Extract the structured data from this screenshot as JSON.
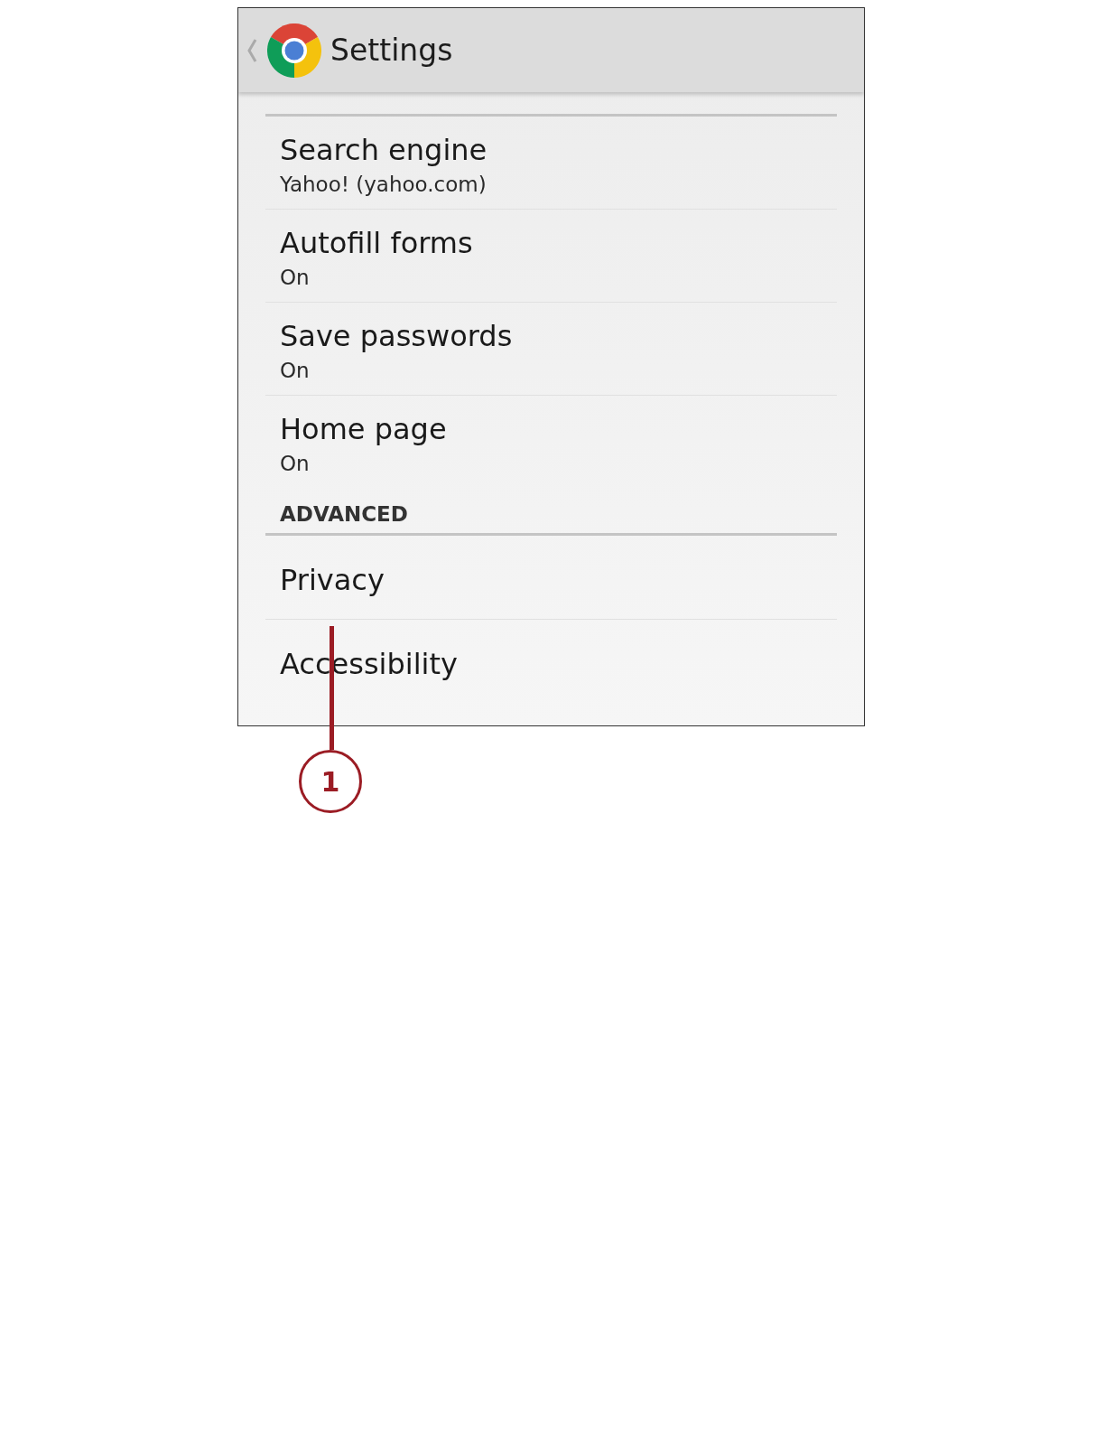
{
  "header": {
    "title": "Settings"
  },
  "items": [
    {
      "kind": "setting",
      "title": "Search engine",
      "summary": "Yahoo! (yahoo.com)"
    },
    {
      "kind": "setting",
      "title": "Autofill forms",
      "summary": "On"
    },
    {
      "kind": "setting",
      "title": "Save passwords",
      "summary": "On"
    },
    {
      "kind": "setting",
      "title": "Home page",
      "summary": "On"
    },
    {
      "kind": "heading",
      "title": "ADVANCED"
    },
    {
      "kind": "setting",
      "title": "Privacy"
    },
    {
      "kind": "setting",
      "title": "Accessibility"
    }
  ],
  "callout": {
    "label": "1"
  }
}
